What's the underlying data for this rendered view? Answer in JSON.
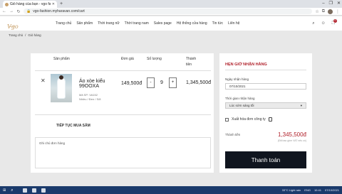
{
  "browser": {
    "tab_title": "Giỏ hàng của bạn - vgo fashion",
    "new_tab": "+",
    "url": "vgo-fashion.myharavan.com/cart",
    "window_controls": [
      "–",
      "❐",
      "✕"
    ]
  },
  "site": {
    "logo": "Vgo",
    "logo_sub": "fashion",
    "nav": [
      "Trang chủ",
      "Sản phẩm",
      "Thời trang nữ",
      "Thời trang nam",
      "Sales page",
      "Hệ thống cửa hàng",
      "Tin tức",
      "Liên hệ"
    ],
    "cart_count": "0"
  },
  "breadcrumb": {
    "home": "Trang chủ",
    "sep": "/",
    "current": "Giỏ hàng"
  },
  "cart": {
    "headers": {
      "product": "Sản phẩm",
      "price": "Đơn giá",
      "quantity": "Số lượng",
      "total_line1": "Thành",
      "total_line2": "tiền"
    },
    "item": {
      "remove": "✕",
      "name": "Áo xòe kiểu 99OOXA",
      "sku": "Mã SP: VA152",
      "variant": "Nhiều / Đen / S/8",
      "price": "149,500đ",
      "qty_minus": "-",
      "qty": "9",
      "qty_plus": "+",
      "line_total": "1,345,500đ"
    },
    "continue_label": "TIẾP TỤC MUA SẮM",
    "note_placeholder": "Ghi chú đơn hàng"
  },
  "order": {
    "title": "HẸN GIỜ NHẬN HÀNG",
    "date_label": "Ngày nhận hàng",
    "date_value": "07/10/2021",
    "time_label": "Thời gian nhận hàng",
    "time_value": "Lúc sớm sáng tối",
    "invoice_label": "Xuất hóa đơn công ty",
    "total_label": "Thành tiền",
    "total_value": "1,345,500đ",
    "vat_note": "(Đã bao gồm VAT nếu có)",
    "pay_button": "Thanh toán"
  },
  "taskbar": {
    "weather": "33°C Light rain",
    "lang": "ENG",
    "time": "10:41",
    "date": "07/10/2021"
  }
}
